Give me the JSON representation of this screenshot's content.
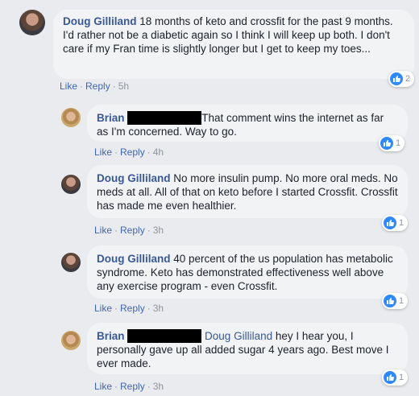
{
  "comments": [
    {
      "author": "Doug Gilliland",
      "text": "18 months of keto and crossfit for the past 9 months. I'd rather not be a diabetic again so I think I will keep up both. I don't care if my Fran time is slightly longer but I get to keep my toes...",
      "like_label": "Like",
      "reply_label": "Reply",
      "time": "5h",
      "reaction_count": "2"
    },
    {
      "author": "Brian",
      "text": "That comment wins the internet as far as I'm concerned. Way to go.",
      "like_label": "Like",
      "reply_label": "Reply",
      "time": "4h",
      "reaction_count": "1"
    },
    {
      "author": "Doug Gilliland",
      "text": "No more insulin pump. No more oral meds. No meds at all. All of that on keto before I started Crossfit. Crossfit has made me even healthier.",
      "like_label": "Like",
      "reply_label": "Reply",
      "time": "3h",
      "reaction_count": "1"
    },
    {
      "author": "Doug Gilliland",
      "text": "40 percent of the us population has metabolic syndrome. Keto has demonstrated effectiveness well above any exercise program - even Crossfit.",
      "like_label": "Like",
      "reply_label": "Reply",
      "time": "3h",
      "reaction_count": "1"
    },
    {
      "author": "Brian",
      "mention": "Doug Gilliland",
      "text": "hey I hear you, I personally gave up all added sugar 4 years ago. Best move I ever made.",
      "like_label": "Like",
      "reply_label": "Reply",
      "time": "3h",
      "reaction_count": "1"
    }
  ],
  "icons": {
    "reaction": "like-thumbs-up-icon"
  },
  "colors": {
    "link": "#385898",
    "like_badge": "#2e89ff",
    "bubble": "#f2f3f5"
  }
}
